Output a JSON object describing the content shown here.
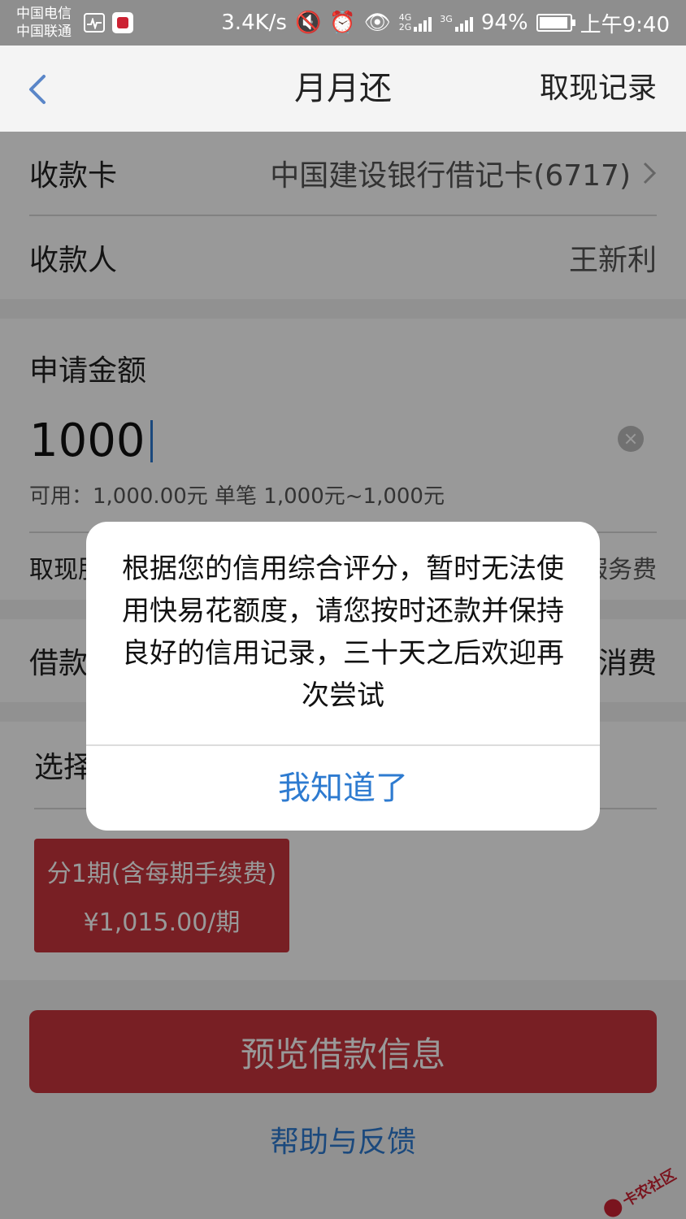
{
  "status_bar": {
    "carrier_1": "中国电信",
    "carrier_2": "中国联通",
    "speed": "3.4K/s",
    "net_1": "4G",
    "net_2": "2G",
    "net_3": "3G",
    "battery": "94%",
    "time": "上午9:40"
  },
  "nav": {
    "title": "月月还",
    "right_link": "取现记录"
  },
  "form": {
    "card_label": "收款卡",
    "card_value": "中国建设银行借记卡(6717)",
    "payee_label": "收款人",
    "payee_value": "王新利",
    "amount_label": "申请金额",
    "amount_value": "1000",
    "available": "可用：1,000.00元 单笔 1,000元~1,000元",
    "fee_label": "取现服务费",
    "fee_value": "每次%服务费",
    "purpose_label": "借款用途",
    "purpose_value": "个人日常消费",
    "period_label": "选择期数",
    "period_option_title": "分1期(含每期手续费)",
    "period_option_amount": "¥1,015.00/期",
    "preview_button": "预览借款信息",
    "help_link": "帮助与反馈"
  },
  "dialog": {
    "message": "根据您的信用综合评分，暂时无法使用快易花额度，请您按时还款并保持良好的信用记录，三十天之后欢迎再次尝试",
    "button": "我知道了"
  },
  "watermark": {
    "text": "卡农社区"
  },
  "colors": {
    "accent_red": "#c8353c",
    "link_blue": "#2e7bd0",
    "overlay": "rgba(0,0,0,0.40)"
  }
}
